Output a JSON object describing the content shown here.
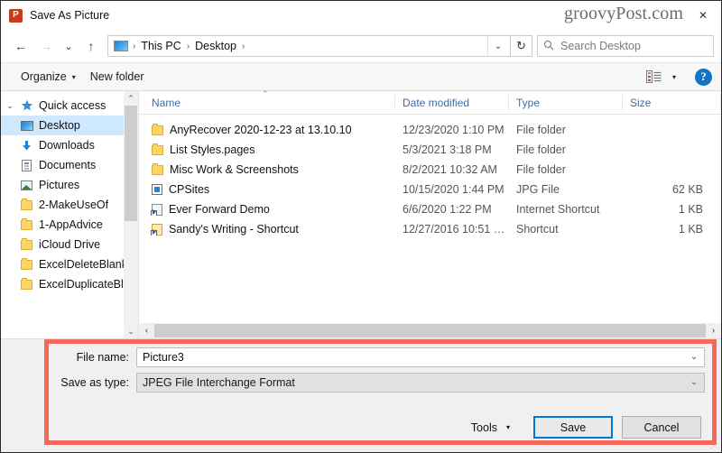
{
  "window": {
    "title": "Save As Picture",
    "app_icon": "powerpoint-icon",
    "app_icon_letter": "P",
    "watermark": "groovyPost.com",
    "close_label": "✕",
    "accent_color": "#0078d7",
    "highlight_color": "#f4695a"
  },
  "nav": {
    "back": "←",
    "forward": "→",
    "recent": "⌄",
    "up": "↑",
    "breadcrumbs": [
      "This PC",
      "Desktop"
    ],
    "breadcrumb_sep": "›",
    "address_caret": "⌄",
    "refresh": "↻",
    "search_placeholder": "Search Desktop",
    "search_value": "",
    "search_icon": "search-icon"
  },
  "toolbar": {
    "organize_label": "Organize",
    "organize_caret": "▾",
    "new_folder_label": "New folder",
    "view_caret": "▾",
    "help_label": "?"
  },
  "sidebar": {
    "items": [
      {
        "label": "Quick access",
        "icon": "star-icon",
        "expanded": true,
        "selected": false,
        "pinned": false,
        "level": 0
      },
      {
        "label": "Desktop",
        "icon": "desktop-icon",
        "selected": true,
        "pinned": true,
        "level": 1
      },
      {
        "label": "Downloads",
        "icon": "downloads-icon",
        "selected": false,
        "pinned": true,
        "level": 1
      },
      {
        "label": "Documents",
        "icon": "documents-icon",
        "selected": false,
        "pinned": true,
        "level": 1
      },
      {
        "label": "Pictures",
        "icon": "pictures-icon",
        "selected": false,
        "pinned": true,
        "level": 1
      },
      {
        "label": "2-MakeUseOf",
        "icon": "folder-icon",
        "selected": false,
        "pinned": true,
        "level": 1
      },
      {
        "label": "1-AppAdvice",
        "icon": "folder-icon",
        "selected": false,
        "pinned": true,
        "level": 1
      },
      {
        "label": "iCloud Drive",
        "icon": "folder-icon",
        "selected": false,
        "pinned": true,
        "level": 1
      },
      {
        "label": "ExcelDeleteBlank",
        "icon": "folder-icon",
        "selected": false,
        "pinned": false,
        "level": 1
      },
      {
        "label": "ExcelDuplicateBl",
        "icon": "folder-icon",
        "selected": false,
        "pinned": false,
        "level": 1
      }
    ],
    "expand_caret": "⌄",
    "pin_icon": "✐",
    "scroll_up": "⌃",
    "scroll_down": "⌄"
  },
  "filelist": {
    "columns": [
      "Name",
      "Date modified",
      "Type",
      "Size"
    ],
    "sort_column": "Name",
    "sort_caret": "⌃",
    "rows": [
      {
        "name": "AnyRecover 2020-12-23 at 13.10.10",
        "icon": "folder-icon",
        "date": "12/23/2020 1:10 PM",
        "type": "File folder",
        "size": ""
      },
      {
        "name": "List Styles.pages",
        "icon": "folder-icon",
        "date": "5/3/2021 3:18 PM",
        "type": "File folder",
        "size": ""
      },
      {
        "name": "Misc Work & Screenshots",
        "icon": "folder-icon",
        "date": "8/2/2021 10:32 AM",
        "type": "File folder",
        "size": ""
      },
      {
        "name": "CPSites",
        "icon": "jpg-file-icon",
        "date": "10/15/2020 1:44 PM",
        "type": "JPG File",
        "size": "62 KB"
      },
      {
        "name": "Ever Forward Demo",
        "icon": "internet-shortcut-icon",
        "date": "6/6/2020 1:22 PM",
        "type": "Internet Shortcut",
        "size": "1 KB"
      },
      {
        "name": "Sandy's Writing - Shortcut",
        "icon": "shortcut-icon",
        "date": "12/27/2016 10:51 …",
        "type": "Shortcut",
        "size": "1 KB"
      }
    ],
    "hscroll_left": "‹",
    "hscroll_right": "›"
  },
  "form": {
    "file_name_label": "File name:",
    "file_name_value": "Picture3",
    "file_name_placeholder": "",
    "save_as_type_label": "Save as type:",
    "save_as_type_value": "JPEG File Interchange Format",
    "combo_caret": "⌄"
  },
  "buttons": {
    "tools_label": "Tools",
    "tools_caret": "▾",
    "save_label": "Save",
    "cancel_label": "Cancel"
  }
}
